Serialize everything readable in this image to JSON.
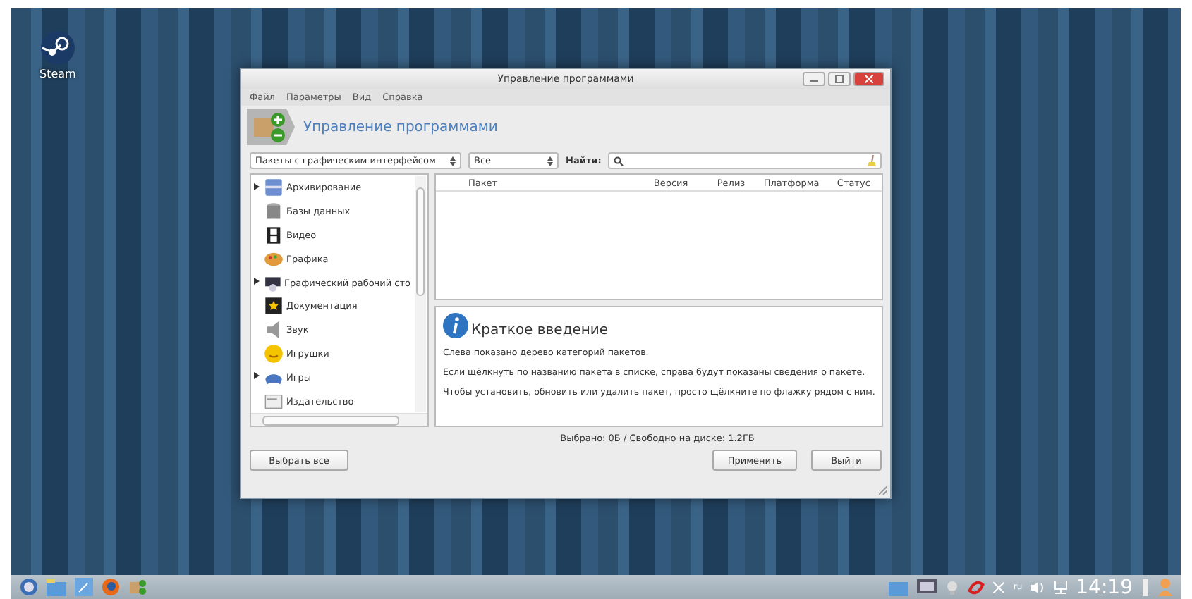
{
  "desktop_icons": [
    {
      "label": "Steam"
    }
  ],
  "window": {
    "title": "Управление программами",
    "menu": [
      "Файл",
      "Параметры",
      "Вид",
      "Справка"
    ],
    "header": "Управление программами"
  },
  "filters": {
    "group": "Пакеты с графическим интерфейсом",
    "status": "Все",
    "search_label": "Найти:"
  },
  "categories": [
    {
      "label": "Архивирование",
      "expandable": true
    },
    {
      "label": "Базы данных",
      "expandable": false
    },
    {
      "label": "Видео",
      "expandable": false
    },
    {
      "label": "Графика",
      "expandable": false
    },
    {
      "label": "Графический рабочий сто",
      "expandable": true
    },
    {
      "label": "Документация",
      "expandable": false
    },
    {
      "label": "Звук",
      "expandable": false
    },
    {
      "label": "Игрушки",
      "expandable": false
    },
    {
      "label": "Игры",
      "expandable": true
    },
    {
      "label": "Издательство",
      "expandable": false
    }
  ],
  "table": {
    "columns": [
      "Пакет",
      "Версия",
      "Релиз",
      "Платформа",
      "Статус"
    ]
  },
  "intro": {
    "title": "Краткое введение",
    "paragraphs": [
      "Слева показано дерево категорий пакетов.",
      "Если щёлкнуть по названию пакета в списке, справа будут показаны сведения о пакете.",
      "Чтобы установить, обновить или удалить пакет, просто щёлкните по флажку рядом с ним."
    ]
  },
  "status_bar": "Выбрано: 0Б / Свободно на диске: 1.2ГБ",
  "buttons": {
    "select_all": "Выбрать все",
    "apply": "Применить",
    "quit": "Выйти"
  },
  "taskbar": {
    "layout": "ru",
    "clock": "14:19"
  }
}
